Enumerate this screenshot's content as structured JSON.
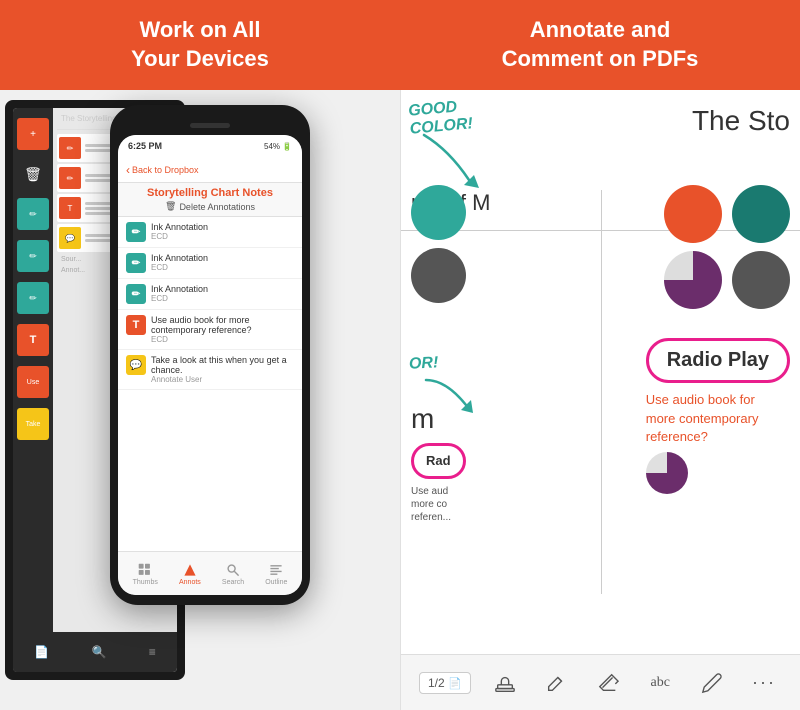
{
  "header": {
    "left_title_line1": "Work on All",
    "left_title_line2": "Your Devices",
    "right_title_line1": "Annotate and",
    "right_title_line2": "Comment on PDFs",
    "accent_color": "#E8522A"
  },
  "phone": {
    "status_time": "6:25 PM",
    "status_battery": "54%",
    "back_label": "Back to Dropbox",
    "screen_title": "Storytelling Chart Notes",
    "delete_btn": "Delete Annotations",
    "annotations": [
      {
        "type": "teal",
        "title": "Ink Annotation",
        "subtitle": "ECD",
        "icon": "✏"
      },
      {
        "type": "teal",
        "title": "Ink Annotation",
        "subtitle": "ECD",
        "icon": "✏"
      },
      {
        "type": "teal",
        "title": "Ink Annotation",
        "subtitle": "ECD",
        "icon": "✏"
      },
      {
        "type": "red",
        "title": "Use audio book for more contemporary reference?",
        "subtitle": "ECD",
        "icon": "T"
      },
      {
        "type": "yellow",
        "title": "Take a look at this when you get a chance.",
        "subtitle": "Annotate User",
        "icon": "💬"
      }
    ],
    "bottom_tabs": [
      {
        "label": "Thumbs",
        "active": false
      },
      {
        "label": "Annots",
        "active": true
      },
      {
        "label": "Search",
        "active": false
      },
      {
        "label": "Outline",
        "active": false
      }
    ]
  },
  "pdf": {
    "title": "The Sto",
    "handwritten_annotation": "GOOD\nCOLOR!",
    "radio_play_label": "Radio Play",
    "comment_text": "Use audio book for\nmore contemporary\nreference?",
    "page_indicator": "1/2",
    "toolbar_buttons": [
      "page",
      "stamp",
      "highlight",
      "erase",
      "text",
      "pen",
      "more"
    ]
  }
}
